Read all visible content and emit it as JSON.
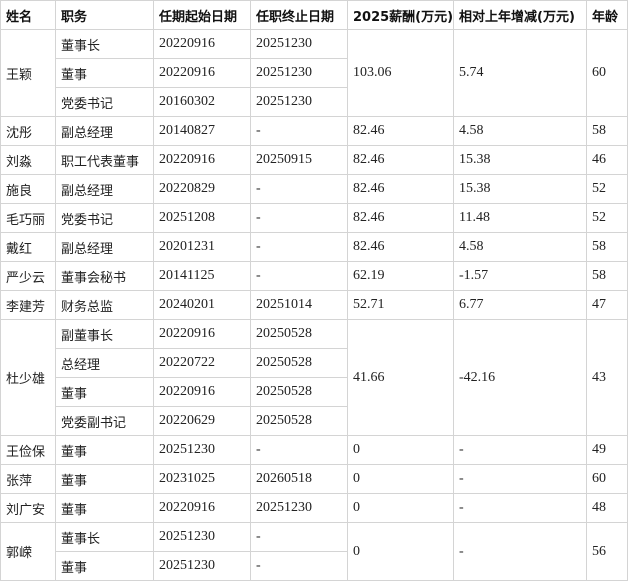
{
  "headers": [
    "姓名",
    "职务",
    "任期起始日期",
    "任职终止日期",
    "2025薪酬(万元)",
    "相对上年增减(万元)",
    "年龄"
  ],
  "persons": [
    {
      "name": "王颖",
      "salary": "103.06",
      "change": "5.74",
      "age": "60",
      "roles": [
        {
          "title": "董事长",
          "start": "20220916",
          "end": "20251230"
        },
        {
          "title": "董事",
          "start": "20220916",
          "end": "20251230"
        },
        {
          "title": "党委书记",
          "start": "20160302",
          "end": "20251230"
        }
      ]
    },
    {
      "name": "沈彤",
      "salary": "82.46",
      "change": "4.58",
      "age": "58",
      "roles": [
        {
          "title": "副总经理",
          "start": "20140827",
          "end": "-"
        }
      ]
    },
    {
      "name": "刘淼",
      "salary": "82.46",
      "change": "15.38",
      "age": "46",
      "roles": [
        {
          "title": "职工代表董事",
          "start": "20220916",
          "end": "20250915"
        }
      ]
    },
    {
      "name": "施良",
      "salary": "82.46",
      "change": "15.38",
      "age": "52",
      "roles": [
        {
          "title": "副总经理",
          "start": "20220829",
          "end": "-"
        }
      ]
    },
    {
      "name": "毛巧丽",
      "salary": "82.46",
      "change": "11.48",
      "age": "52",
      "roles": [
        {
          "title": "党委书记",
          "start": "20251208",
          "end": "-"
        }
      ]
    },
    {
      "name": "戴红",
      "salary": "82.46",
      "change": "4.58",
      "age": "58",
      "roles": [
        {
          "title": "副总经理",
          "start": "20201231",
          "end": "-"
        }
      ]
    },
    {
      "name": "严少云",
      "salary": "62.19",
      "change": "-1.57",
      "age": "58",
      "roles": [
        {
          "title": "董事会秘书",
          "start": "20141125",
          "end": "-"
        }
      ]
    },
    {
      "name": "李建芳",
      "salary": "52.71",
      "change": "6.77",
      "age": "47",
      "roles": [
        {
          "title": "财务总监",
          "start": "20240201",
          "end": "20251014"
        }
      ]
    },
    {
      "name": "杜少雄",
      "salary": "41.66",
      "change": "-42.16",
      "age": "43",
      "roles": [
        {
          "title": "副董事长",
          "start": "20220916",
          "end": "20250528"
        },
        {
          "title": "总经理",
          "start": "20220722",
          "end": "20250528"
        },
        {
          "title": "董事",
          "start": "20220916",
          "end": "20250528"
        },
        {
          "title": "党委副书记",
          "start": "20220629",
          "end": "20250528"
        }
      ]
    },
    {
      "name": "王俭保",
      "salary": "0",
      "change": "-",
      "age": "49",
      "roles": [
        {
          "title": "董事",
          "start": "20251230",
          "end": "-"
        }
      ]
    },
    {
      "name": "张萍",
      "salary": "0",
      "change": "-",
      "age": "60",
      "roles": [
        {
          "title": "董事",
          "start": "20231025",
          "end": "20260518"
        }
      ]
    },
    {
      "name": "刘广安",
      "salary": "0",
      "change": "-",
      "age": "48",
      "roles": [
        {
          "title": "董事",
          "start": "20220916",
          "end": "20251230"
        }
      ]
    },
    {
      "name": "郭嵘",
      "salary": "0",
      "change": "-",
      "age": "56",
      "roles": [
        {
          "title": "董事长",
          "start": "20251230",
          "end": "-"
        },
        {
          "title": "董事",
          "start": "20251230",
          "end": "-"
        }
      ]
    }
  ]
}
